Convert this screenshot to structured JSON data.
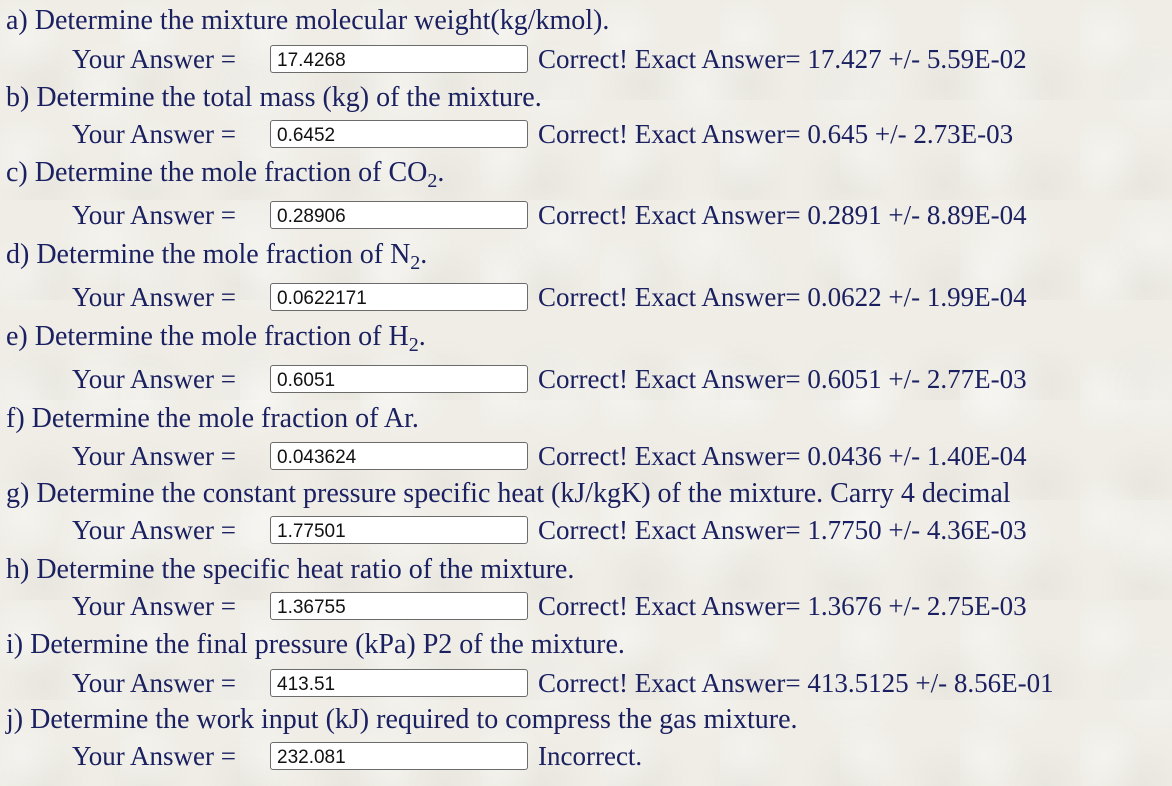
{
  "answer_label": "Your Answer =",
  "problems": [
    {
      "question": "a) Determine the mixture molecular weight(kg/kmol).",
      "answer": "17.4268",
      "feedback": "Correct! Exact Answer= 17.427 +/- 5.59E-02"
    },
    {
      "question": "b) Determine the total mass (kg) of the mixture.",
      "answer": "0.6452",
      "feedback": "Correct! Exact Answer= 0.645 +/- 2.73E-03"
    },
    {
      "question_pre": "c) Determine the mole fraction of CO",
      "question_sub": "2",
      "question_post": ".",
      "answer": "0.28906",
      "feedback": "Correct! Exact Answer= 0.2891 +/- 8.89E-04"
    },
    {
      "question_pre": "d) Determine the mole fraction of N",
      "question_sub": "2",
      "question_post": ".",
      "answer": "0.0622171",
      "feedback": "Correct! Exact Answer= 0.0622 +/- 1.99E-04"
    },
    {
      "question_pre": "e) Determine the mole fraction of H",
      "question_sub": "2",
      "question_post": ".",
      "answer": "0.6051",
      "feedback": "Correct! Exact Answer= 0.6051 +/- 2.77E-03"
    },
    {
      "question": "f) Determine the mole fraction of Ar.",
      "answer": "0.043624",
      "feedback": "Correct! Exact Answer= 0.0436 +/- 1.40E-04"
    },
    {
      "question": "g) Determine the constant pressure specific heat (kJ/kgK) of the mixture. Carry 4 decimal",
      "answer": "1.77501",
      "feedback": "Correct! Exact Answer= 1.7750 +/- 4.36E-03"
    },
    {
      "question": "h) Determine the specific heat ratio of the mixture.",
      "answer": "1.36755",
      "feedback": "Correct! Exact Answer= 1.3676 +/- 2.75E-03"
    },
    {
      "question": "i) Determine the final pressure (kPa) P2 of the mixture.",
      "answer": "413.51",
      "feedback": "Correct! Exact Answer= 413.5125 +/- 8.56E-01"
    },
    {
      "question": "j) Determine the work input (kJ) required to compress the gas mixture.",
      "answer": "232.081",
      "feedback": "Incorrect."
    }
  ]
}
